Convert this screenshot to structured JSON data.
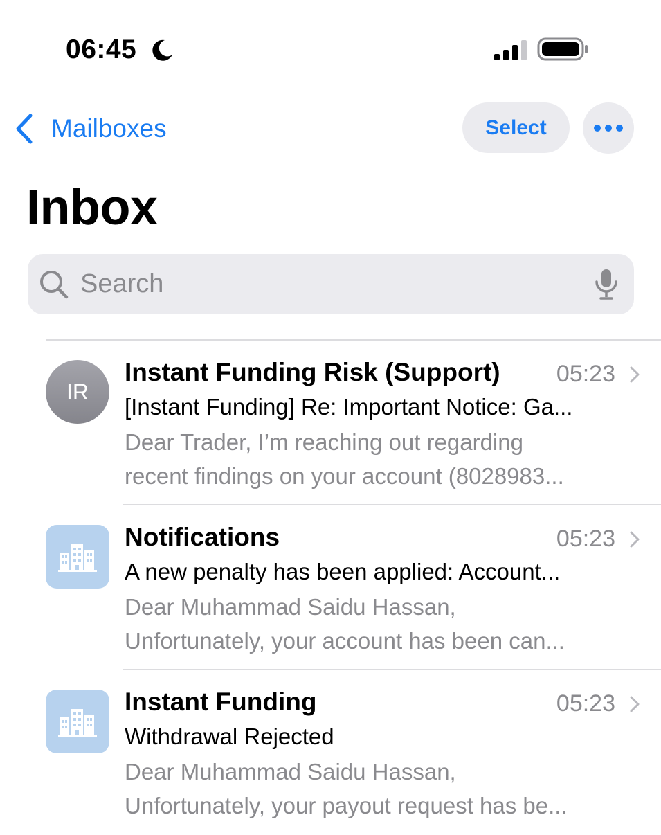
{
  "status_bar": {
    "time": "06:45"
  },
  "nav": {
    "back_label": "Mailboxes",
    "select_label": "Select"
  },
  "title": "Inbox",
  "search": {
    "placeholder": "Search"
  },
  "emails": [
    {
      "avatar_type": "initials",
      "initials": "IR",
      "sender": "Instant Funding Risk (Support)",
      "time": "05:23",
      "subject": "[Instant Funding] Re: Important Notice: Ga...",
      "preview_line_1": "Dear Trader, I’m reaching out regarding",
      "preview_line_2": "recent findings on your account (8028983..."
    },
    {
      "avatar_type": "building-icon",
      "sender": "Notifications",
      "time": "05:23",
      "subject": "A new penalty has been applied: Account...",
      "preview_line_1": "Dear Muhammad Saidu Hassan,",
      "preview_line_2": "Unfortunately, your account has been can..."
    },
    {
      "avatar_type": "building-icon",
      "sender": "Instant Funding",
      "time": "05:23",
      "subject": "Withdrawal Rejected",
      "preview_line_1": "Dear Muhammad Saidu Hassan,",
      "preview_line_2": "Unfortunately, your payout request has be..."
    }
  ],
  "colors": {
    "accent": "#1a7cf2",
    "secondary_text": "#8a8a8e",
    "control_background": "#ebebef",
    "building_avatar": "#b7d2ee"
  }
}
